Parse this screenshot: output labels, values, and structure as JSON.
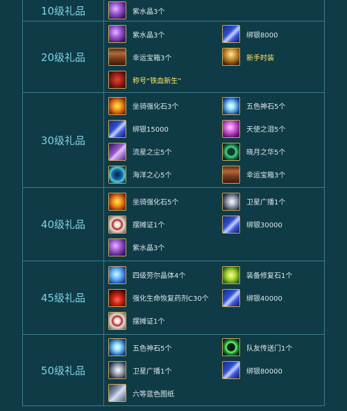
{
  "rows": [
    {
      "level": "10级礼品",
      "items": [
        {
          "icon": "purple-crystal-icon",
          "label": "紫水晶3个"
        }
      ]
    },
    {
      "level": "20级礼品",
      "items": [
        {
          "icon": "purple-crystal-icon",
          "label": "紫水晶3个"
        },
        {
          "icon": "bound-silver-icon",
          "label": "绑银8000"
        },
        {
          "icon": "treasure-chest-icon",
          "label": "幸运宝箱3个"
        },
        {
          "icon": "costume-icon",
          "label": "新手时装",
          "highlight": true
        },
        {
          "icon": "title-badge-icon",
          "label": "称号“铁血新生”",
          "highlight": true
        }
      ]
    },
    {
      "level": "30级礼品",
      "items": [
        {
          "icon": "mount-stone-icon",
          "label": "坐骑强化石3个"
        },
        {
          "icon": "five-color-stone-icon",
          "label": "五色神石5个"
        },
        {
          "icon": "bound-silver-icon",
          "label": "绑银15000"
        },
        {
          "icon": "angel-tear-icon",
          "label": "天使之泪5个"
        },
        {
          "icon": "stardust-icon",
          "label": "流星之尘5个"
        },
        {
          "icon": "moon-essence-icon",
          "label": "晓月之华5个"
        },
        {
          "icon": "ocean-heart-icon",
          "label": "海洋之心5个"
        },
        {
          "icon": "treasure-chest-icon",
          "label": "幸运宝箱3个"
        }
      ]
    },
    {
      "level": "40级礼品",
      "items": [
        {
          "icon": "mount-stone-icon",
          "label": "坐骑强化石5个"
        },
        {
          "icon": "satellite-broadcast-icon",
          "label": "卫星广播1个"
        },
        {
          "icon": "stall-license-icon",
          "label": "摆摊证1个"
        },
        {
          "icon": "bound-silver-icon",
          "label": "绑银30000"
        },
        {
          "icon": "purple-crystal-icon",
          "label": "紫水晶3个"
        }
      ]
    },
    {
      "level": "45级礼品",
      "items": [
        {
          "icon": "fourth-crystal-icon",
          "label": "四级劳尔晶体4个"
        },
        {
          "icon": "equipment-repair-stone-icon",
          "label": "装备修复石1个"
        },
        {
          "icon": "health-potion-icon",
          "label": "强化生命恢复药剂C30个"
        },
        {
          "icon": "bound-silver-icon",
          "label": "绑银40000"
        },
        {
          "icon": "stall-license-icon",
          "label": "摆摊证1个"
        }
      ]
    },
    {
      "level": "50级礼品",
      "items": [
        {
          "icon": "five-color-stone-icon",
          "label": "五色神石5个"
        },
        {
          "icon": "team-portal-icon",
          "label": "队友传送门1个"
        },
        {
          "icon": "satellite-broadcast-icon",
          "label": "卫星广播1个"
        },
        {
          "icon": "bound-silver-icon",
          "label": "绑银80000"
        },
        {
          "icon": "blueprint-scroll-icon",
          "label": "六等蓝色图纸"
        }
      ]
    }
  ]
}
